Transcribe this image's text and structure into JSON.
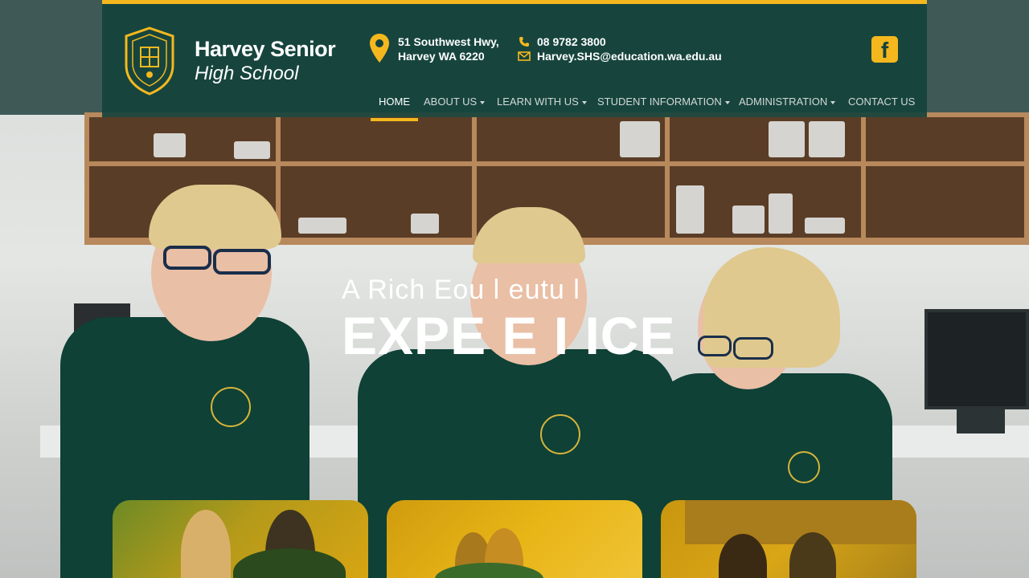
{
  "school": {
    "name_line1": "Harvey Senior",
    "name_line2": "High School"
  },
  "contact": {
    "address_line1": "51 Southwest Hwy,",
    "address_line2": "Harvey WA 6220",
    "phone": "08 9782 3800",
    "email": "Harvey.SHS@education.wa.edu.au"
  },
  "social": {
    "facebook_icon": "facebook-icon",
    "facebook_glyph": "f"
  },
  "nav": {
    "items": [
      {
        "label": "HOME",
        "active": true,
        "dropdown": false
      },
      {
        "label": "ABOUT US",
        "active": false,
        "dropdown": true
      },
      {
        "label": "LEARN WITH US",
        "active": false,
        "dropdown": true
      },
      {
        "label": "STUDENT INFORMATION",
        "active": false,
        "dropdown": true
      },
      {
        "label": "ADMINISTRATION",
        "active": false,
        "dropdown": true
      },
      {
        "label": "CONTACT US",
        "active": false,
        "dropdown": false
      }
    ]
  },
  "hero": {
    "tagline_line1": "A Rich Eou l eutu l",
    "tagline_line2": "EXPE E I ICE"
  },
  "colors": {
    "accent": "#f4b81e",
    "header_bg": "#13423c",
    "uniform": "#0f4136"
  }
}
